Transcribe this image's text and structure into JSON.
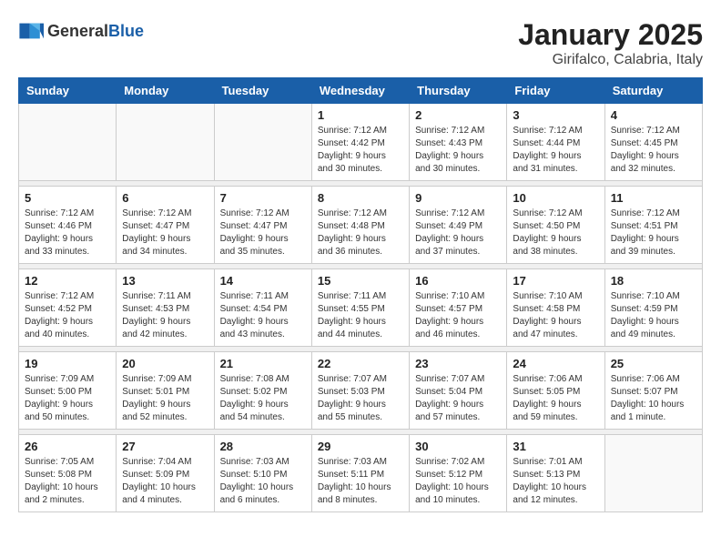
{
  "header": {
    "logo": {
      "general": "General",
      "blue": "Blue"
    },
    "title": "January 2025",
    "subtitle": "Girifalco, Calabria, Italy"
  },
  "weekdays": [
    "Sunday",
    "Monday",
    "Tuesday",
    "Wednesday",
    "Thursday",
    "Friday",
    "Saturday"
  ],
  "weeks": [
    [
      {
        "day": "",
        "info": ""
      },
      {
        "day": "",
        "info": ""
      },
      {
        "day": "",
        "info": ""
      },
      {
        "day": "1",
        "info": "Sunrise: 7:12 AM\nSunset: 4:42 PM\nDaylight: 9 hours\nand 30 minutes."
      },
      {
        "day": "2",
        "info": "Sunrise: 7:12 AM\nSunset: 4:43 PM\nDaylight: 9 hours\nand 30 minutes."
      },
      {
        "day": "3",
        "info": "Sunrise: 7:12 AM\nSunset: 4:44 PM\nDaylight: 9 hours\nand 31 minutes."
      },
      {
        "day": "4",
        "info": "Sunrise: 7:12 AM\nSunset: 4:45 PM\nDaylight: 9 hours\nand 32 minutes."
      }
    ],
    [
      {
        "day": "5",
        "info": "Sunrise: 7:12 AM\nSunset: 4:46 PM\nDaylight: 9 hours\nand 33 minutes."
      },
      {
        "day": "6",
        "info": "Sunrise: 7:12 AM\nSunset: 4:47 PM\nDaylight: 9 hours\nand 34 minutes."
      },
      {
        "day": "7",
        "info": "Sunrise: 7:12 AM\nSunset: 4:47 PM\nDaylight: 9 hours\nand 35 minutes."
      },
      {
        "day": "8",
        "info": "Sunrise: 7:12 AM\nSunset: 4:48 PM\nDaylight: 9 hours\nand 36 minutes."
      },
      {
        "day": "9",
        "info": "Sunrise: 7:12 AM\nSunset: 4:49 PM\nDaylight: 9 hours\nand 37 minutes."
      },
      {
        "day": "10",
        "info": "Sunrise: 7:12 AM\nSunset: 4:50 PM\nDaylight: 9 hours\nand 38 minutes."
      },
      {
        "day": "11",
        "info": "Sunrise: 7:12 AM\nSunset: 4:51 PM\nDaylight: 9 hours\nand 39 minutes."
      }
    ],
    [
      {
        "day": "12",
        "info": "Sunrise: 7:12 AM\nSunset: 4:52 PM\nDaylight: 9 hours\nand 40 minutes."
      },
      {
        "day": "13",
        "info": "Sunrise: 7:11 AM\nSunset: 4:53 PM\nDaylight: 9 hours\nand 42 minutes."
      },
      {
        "day": "14",
        "info": "Sunrise: 7:11 AM\nSunset: 4:54 PM\nDaylight: 9 hours\nand 43 minutes."
      },
      {
        "day": "15",
        "info": "Sunrise: 7:11 AM\nSunset: 4:55 PM\nDaylight: 9 hours\nand 44 minutes."
      },
      {
        "day": "16",
        "info": "Sunrise: 7:10 AM\nSunset: 4:57 PM\nDaylight: 9 hours\nand 46 minutes."
      },
      {
        "day": "17",
        "info": "Sunrise: 7:10 AM\nSunset: 4:58 PM\nDaylight: 9 hours\nand 47 minutes."
      },
      {
        "day": "18",
        "info": "Sunrise: 7:10 AM\nSunset: 4:59 PM\nDaylight: 9 hours\nand 49 minutes."
      }
    ],
    [
      {
        "day": "19",
        "info": "Sunrise: 7:09 AM\nSunset: 5:00 PM\nDaylight: 9 hours\nand 50 minutes."
      },
      {
        "day": "20",
        "info": "Sunrise: 7:09 AM\nSunset: 5:01 PM\nDaylight: 9 hours\nand 52 minutes."
      },
      {
        "day": "21",
        "info": "Sunrise: 7:08 AM\nSunset: 5:02 PM\nDaylight: 9 hours\nand 54 minutes."
      },
      {
        "day": "22",
        "info": "Sunrise: 7:07 AM\nSunset: 5:03 PM\nDaylight: 9 hours\nand 55 minutes."
      },
      {
        "day": "23",
        "info": "Sunrise: 7:07 AM\nSunset: 5:04 PM\nDaylight: 9 hours\nand 57 minutes."
      },
      {
        "day": "24",
        "info": "Sunrise: 7:06 AM\nSunset: 5:05 PM\nDaylight: 9 hours\nand 59 minutes."
      },
      {
        "day": "25",
        "info": "Sunrise: 7:06 AM\nSunset: 5:07 PM\nDaylight: 10 hours\nand 1 minute."
      }
    ],
    [
      {
        "day": "26",
        "info": "Sunrise: 7:05 AM\nSunset: 5:08 PM\nDaylight: 10 hours\nand 2 minutes."
      },
      {
        "day": "27",
        "info": "Sunrise: 7:04 AM\nSunset: 5:09 PM\nDaylight: 10 hours\nand 4 minutes."
      },
      {
        "day": "28",
        "info": "Sunrise: 7:03 AM\nSunset: 5:10 PM\nDaylight: 10 hours\nand 6 minutes."
      },
      {
        "day": "29",
        "info": "Sunrise: 7:03 AM\nSunset: 5:11 PM\nDaylight: 10 hours\nand 8 minutes."
      },
      {
        "day": "30",
        "info": "Sunrise: 7:02 AM\nSunset: 5:12 PM\nDaylight: 10 hours\nand 10 minutes."
      },
      {
        "day": "31",
        "info": "Sunrise: 7:01 AM\nSunset: 5:13 PM\nDaylight: 10 hours\nand 12 minutes."
      },
      {
        "day": "",
        "info": ""
      }
    ]
  ]
}
